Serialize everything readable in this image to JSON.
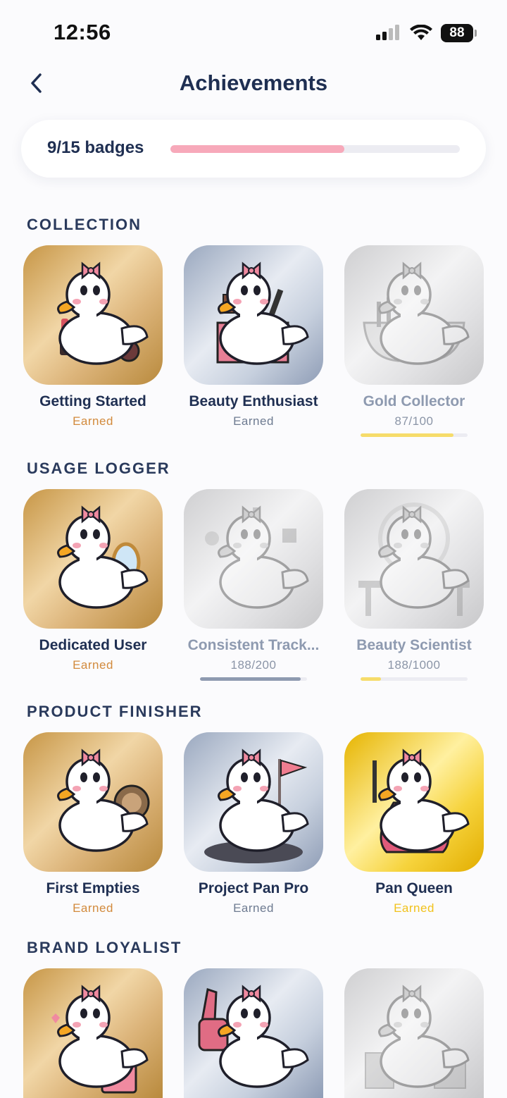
{
  "status_bar": {
    "time": "12:56",
    "battery": "88"
  },
  "nav": {
    "title": "Achievements"
  },
  "progress": {
    "label": "9/15 badges",
    "fraction": 0.6
  },
  "sections": [
    {
      "title": "COLLECTION",
      "badges": [
        {
          "name": "Getting Started",
          "status": "Earned",
          "tier": "gold",
          "icon": "duck-lipstick-icon"
        },
        {
          "name": "Beauty Enthusiast",
          "status": "Earned",
          "tier": "silver",
          "icon": "duck-makeup-box-icon"
        },
        {
          "name": "Gold Collector",
          "status": "87/100",
          "tier": "locked",
          "icon": "duck-bathtub-icon",
          "progress": 0.87,
          "bar_color": "#f6dc6a"
        }
      ]
    },
    {
      "title": "USAGE LOGGER",
      "badges": [
        {
          "name": "Dedicated User",
          "status": "Earned",
          "tier": "gold",
          "icon": "duck-mirror-icon"
        },
        {
          "name": "Consistent Track...",
          "status": "188/200",
          "tier": "locked",
          "icon": "duck-juggling-icon",
          "progress": 0.94,
          "bar_color": "#8e9ab0"
        },
        {
          "name": "Beauty Scientist",
          "status": "188/1000",
          "tier": "locked",
          "icon": "duck-vanity-icon",
          "progress": 0.188,
          "bar_color": "#f6dc6a"
        }
      ]
    },
    {
      "title": "PRODUCT FINISHER",
      "badges": [
        {
          "name": "First Empties",
          "status": "Earned",
          "tier": "gold",
          "icon": "duck-empty-compact-icon"
        },
        {
          "name": "Project Pan Pro",
          "status": "Earned",
          "tier": "silver",
          "icon": "duck-flag-icon"
        },
        {
          "name": "Pan Queen",
          "status": "Earned",
          "tier": "yellow",
          "icon": "duck-superhero-icon"
        }
      ]
    },
    {
      "title": "BRAND LOYALIST",
      "badges": [
        {
          "name": "",
          "status": "",
          "tier": "gold",
          "icon": "duck-shopping-bag-icon"
        },
        {
          "name": "",
          "status": "",
          "tier": "silver",
          "icon": "duck-foam-finger-icon"
        },
        {
          "name": "",
          "status": "",
          "tier": "locked",
          "icon": "duck-vip-icon"
        }
      ]
    }
  ]
}
